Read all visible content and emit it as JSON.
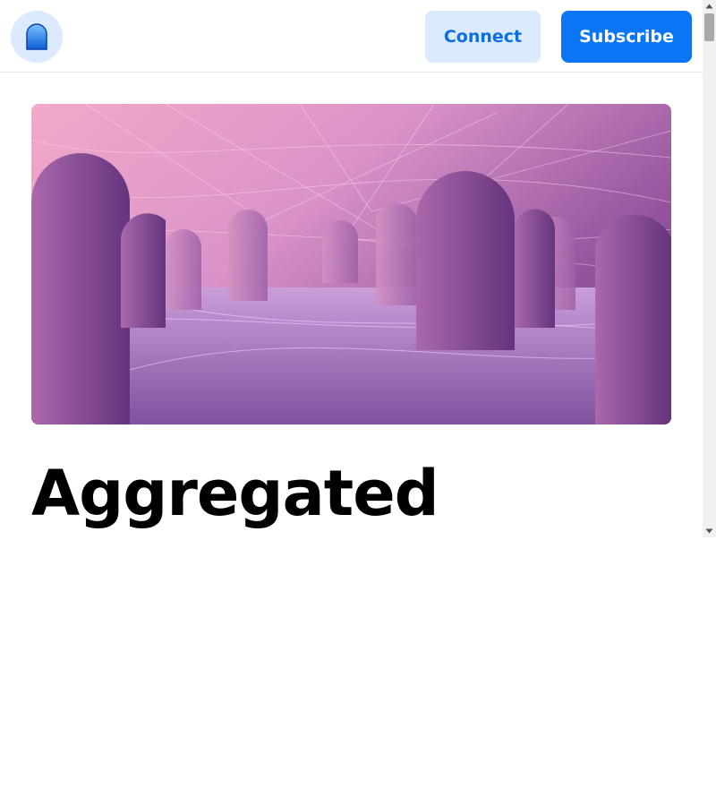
{
  "header": {
    "logo_icon": "arch-logo-icon",
    "connect_label": "Connect",
    "subscribe_label": "Subscribe"
  },
  "hero": {
    "image_description": "purple-network-arches-illustration"
  },
  "article": {
    "title": "Aggregated"
  },
  "colors": {
    "accent": "#0a76f6",
    "accent_light": "#dbeafe",
    "text": "#000000"
  },
  "scrollbar": {
    "up_icon": "scroll-up-arrow-icon",
    "down_icon": "scroll-down-arrow-icon"
  }
}
